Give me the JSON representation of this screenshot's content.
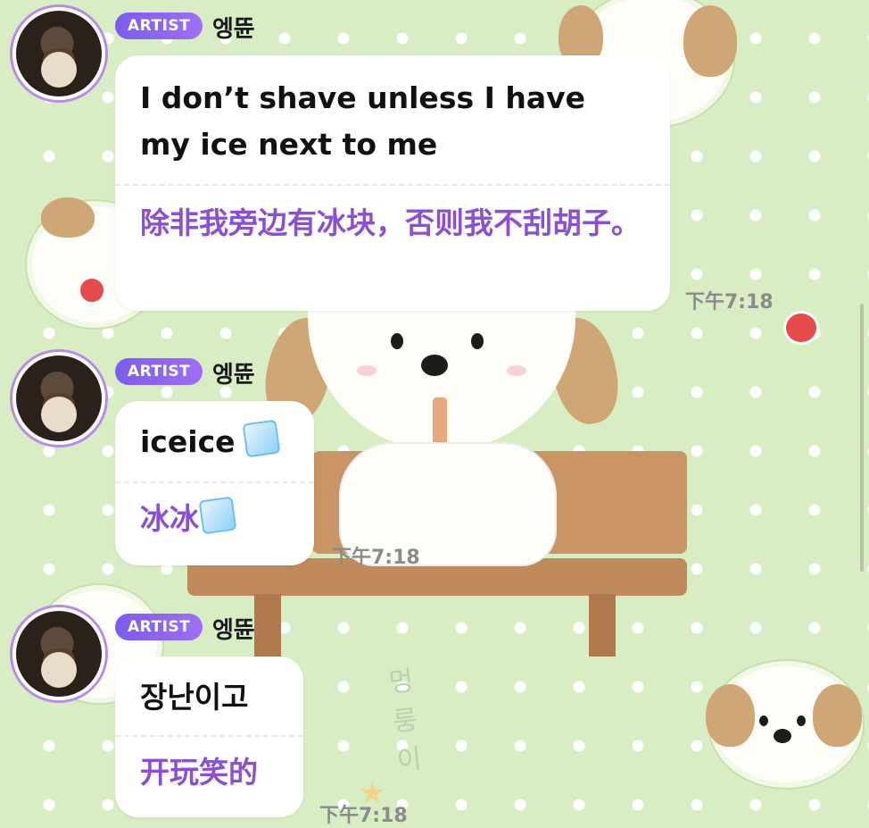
{
  "messages": [
    {
      "badge": "ARTIST",
      "sender": "엥뜐",
      "original": "I don’t shave unless I have my ice next to me",
      "translation": "除非我旁边有冰块，否则我不刮胡子。",
      "time": "下午7:18",
      "emoji": ""
    },
    {
      "badge": "ARTIST",
      "sender": "엥뜐",
      "original": "iceice",
      "translation": "冰冰",
      "time": "下午7:18",
      "emoji": "ice-cube-icon"
    },
    {
      "badge": "ARTIST",
      "sender": "엥뜐",
      "original": "장난이고",
      "translation": "开玩笑的",
      "time": "下午7:18",
      "emoji": ""
    }
  ],
  "decoration": {
    "handwriting": "멍룽이"
  },
  "colors": {
    "background": "#d9edc4",
    "badge": "#8a5df2",
    "translation": "#8a4ed8",
    "time": "#8b8b8b"
  }
}
